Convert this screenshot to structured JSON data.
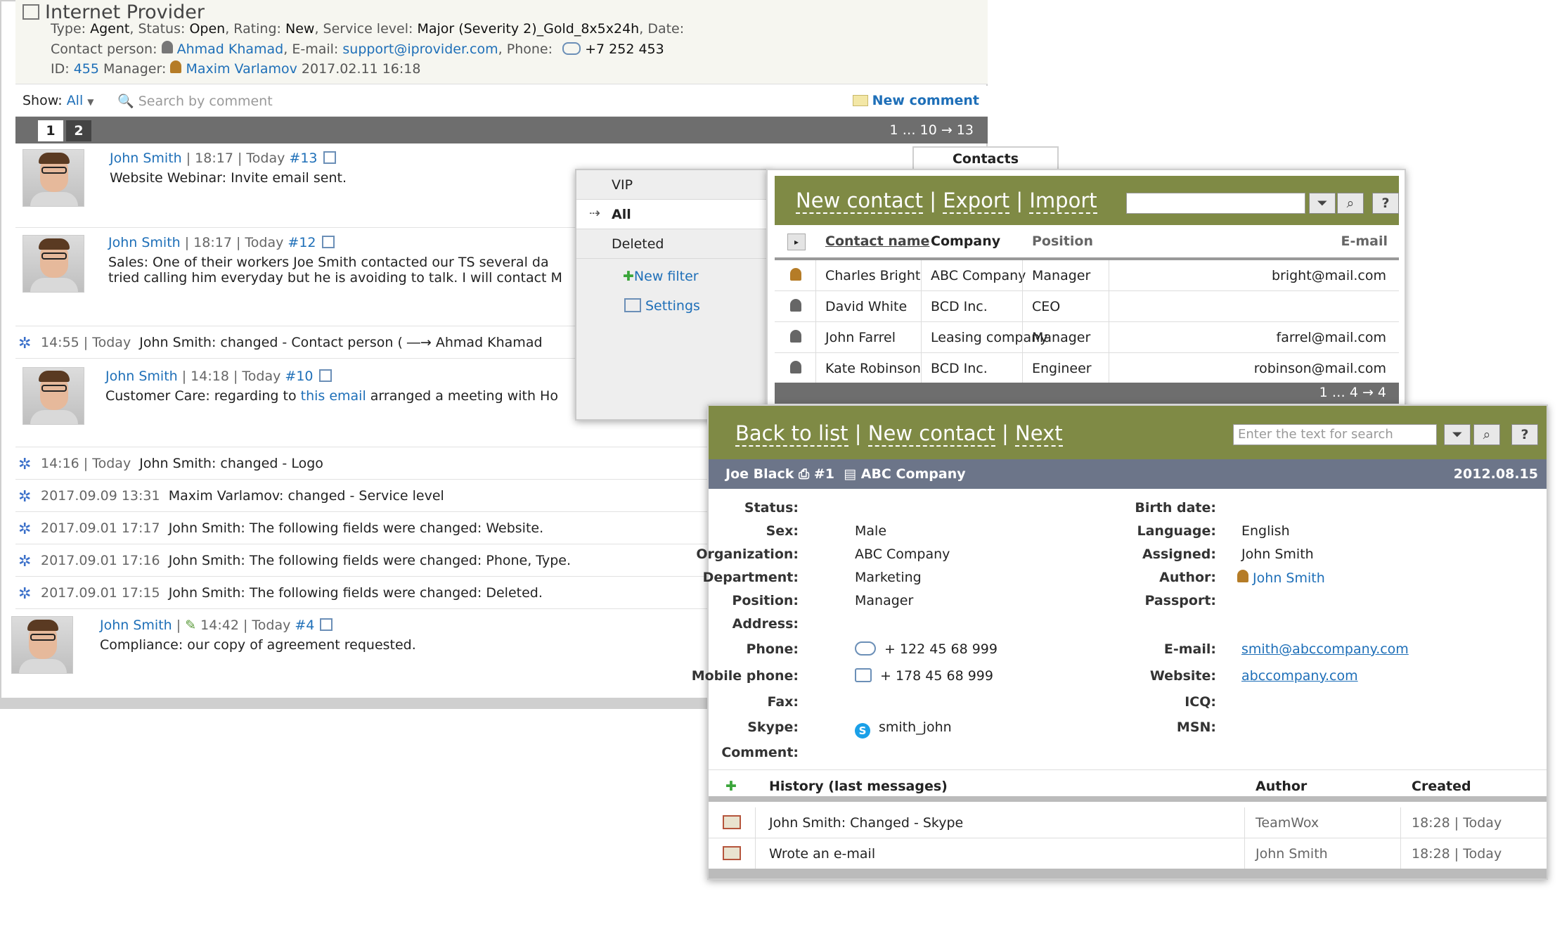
{
  "provider": {
    "title": "Internet Provider",
    "meta_line1": {
      "type_label": "Type:",
      "type": "Agent",
      "status_label": "Status:",
      "status": "Open",
      "rating_label": "Rating:",
      "rating": "New",
      "service_label": "Service level:",
      "service": "Major (Severity 2)_Gold_8x5x24h",
      "date_label": "Date:"
    },
    "meta_line2": {
      "contact_label": "Contact person:",
      "contact": "Ahmad Khamad",
      "email_label": "E-mail:",
      "email": "support@iprovider.com",
      "phone_label": "Phone:",
      "phone": "+7 252 453"
    },
    "meta_line3": {
      "id_label": "ID:",
      "id": "455",
      "manager_label": "Manager:",
      "manager": "Maxim Varlamov",
      "datetime": "2017.02.11 16:18"
    },
    "toolbar": {
      "show_label": "Show:",
      "show_value": "All",
      "search_placeholder": "Search by comment",
      "new_comment": "New comment"
    },
    "pager": {
      "page1": "1",
      "page2": "2",
      "range": "1 … 10 → 13"
    },
    "comments": [
      {
        "author": "John Smith",
        "meta": " | 18:17 | Today ",
        "num": "#13",
        "text": "Website Webinar: Invite email sent."
      },
      {
        "author": "John Smith",
        "meta": " | 18:17 | Today ",
        "num": "#12",
        "text": "Sales: One of their workers Joe Smith contacted our TS several da",
        "text2": "tried calling him everyday but he is avoiding to talk. I will contact M"
      },
      {
        "author": "John Smith",
        "meta": " | 14:18 | Today ",
        "num": "#10",
        "text_a": "Customer Care: regarding to ",
        "text_link": "this email",
        "text_b": " arranged a meeting with Ho"
      },
      {
        "author": "John Smith",
        "meta": "14:42 | Today ",
        "num": "#4",
        "text": "Compliance: our copy of agreement requested."
      }
    ],
    "logs": [
      {
        "time": "14:55 | Today",
        "text": "John Smith: changed - Contact person ( ―→ Ahmad Khamad"
      },
      {
        "time": "14:16 | Today",
        "text": "John Smith: changed - Logo"
      },
      {
        "time": "2017.09.09 13:31",
        "text": "Maxim Varlamov: changed - Service level"
      },
      {
        "time": "2017.09.01 17:17",
        "text": "John Smith: The following fields were changed: Website."
      },
      {
        "time": "2017.09.01 17:16",
        "text": "John Smith: The following fields were changed: Phone, Type."
      },
      {
        "time": "2017.09.01 17:15",
        "text": "John Smith: The following fields were changed: Deleted."
      }
    ]
  },
  "contacts": {
    "tab": "Contacts",
    "filters": [
      "VIP",
      "All",
      "Deleted"
    ],
    "new_filter": "New filter",
    "settings": "Settings",
    "actions": {
      "new_contact": "New contact",
      "export": "Export",
      "import": "Import",
      "sep": " | "
    },
    "columns": {
      "name": "Contact name",
      "company": "Company",
      "position": "Position",
      "email": "E-mail"
    },
    "rows": [
      {
        "name": "Charles Bright",
        "company": "ABC Company",
        "position": "Manager",
        "email": "bright@mail.com"
      },
      {
        "name": "David White",
        "company": "BCD Inc.",
        "position": "CEO",
        "email": ""
      },
      {
        "name": "John Farrel",
        "company": "Leasing company",
        "position": "Manager",
        "email": "farrel@mail.com"
      },
      {
        "name": "Kate Robinson",
        "company": "BCD Inc.",
        "position": "Engineer",
        "email": "robinson@mail.com"
      }
    ],
    "pager": "1 … 4 → 4"
  },
  "card": {
    "actions": {
      "back": "Back to list",
      "new_contact": "New contact",
      "next": "Next",
      "sep": " | "
    },
    "search_placeholder": "Enter the text for search",
    "record": {
      "name": "Joe Black",
      "num": "#1",
      "company": "ABC Company",
      "date": "2012.08.15"
    },
    "left": [
      {
        "label": "Status:",
        "value": ""
      },
      {
        "label": "Sex:",
        "value": "Male"
      },
      {
        "label": "Organization:",
        "value": "ABC Company"
      },
      {
        "label": "Department:",
        "value": "Marketing"
      },
      {
        "label": "Position:",
        "value": "Manager"
      },
      {
        "label": "Address:",
        "value": ""
      },
      {
        "label": "Phone:",
        "value": "+ 122 45 68 999"
      },
      {
        "label": "Mobile phone:",
        "value": "+ 178 45 68 999"
      },
      {
        "label": "Fax:",
        "value": ""
      },
      {
        "label": "Skype:",
        "value": "smith_john"
      },
      {
        "label": "Comment:",
        "value": ""
      }
    ],
    "right": [
      {
        "label": "Birth date:",
        "value": ""
      },
      {
        "label": "Language:",
        "value": "English"
      },
      {
        "label": "Assigned:",
        "value": "John Smith"
      },
      {
        "label": "Author:",
        "value": "John Smith"
      },
      {
        "label": "Passport:",
        "value": ""
      },
      {
        "label": "E-mail:",
        "value": "smith@abccompany.com"
      },
      {
        "label": "Website:",
        "value": "abccompany.com"
      },
      {
        "label": "ICQ:",
        "value": ""
      },
      {
        "label": "MSN:",
        "value": ""
      }
    ],
    "history": {
      "title": "History (last messages)",
      "author_col": "Author",
      "created_col": "Created",
      "rows": [
        {
          "text": "John Smith: Changed - Skype",
          "author": "TeamWox",
          "created": "18:28 | Today"
        },
        {
          "text": "Wrote an e-mail",
          "author": "John Smith",
          "created": "18:28 | Today"
        }
      ]
    }
  },
  "colors": {
    "accent_bar": "#7f8a45",
    "record_bar": "#6c7589",
    "link": "#1e6fb8",
    "pager": "#6e6e6e"
  }
}
